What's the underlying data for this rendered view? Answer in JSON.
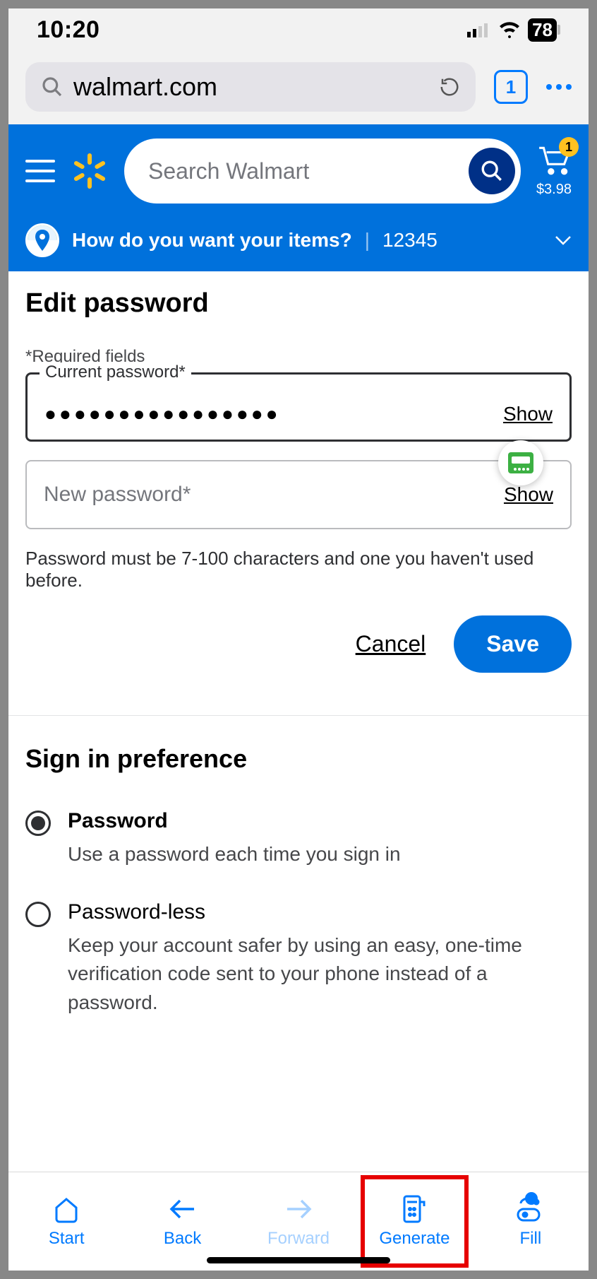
{
  "status": {
    "time": "10:20",
    "battery": "78"
  },
  "safari": {
    "url": "walmart.com",
    "tab_count": "1"
  },
  "header": {
    "search_placeholder": "Search Walmart",
    "cart_badge": "1",
    "cart_total": "$3.98"
  },
  "fulfillment": {
    "question": "How do you want your items?",
    "zip": "12345"
  },
  "edit_password": {
    "heading": "Edit password",
    "required_note": "*Required fields",
    "current_label": "Current password*",
    "current_value_masked": "●●●●●●●●●●●●●●●●",
    "show": "Show",
    "new_label": "New password*",
    "hint": "Password must be 7-100 characters and one you haven't used before.",
    "cancel": "Cancel",
    "save": "Save"
  },
  "signin_pref": {
    "heading": "Sign in preference",
    "options": [
      {
        "title": "Password",
        "desc": "Use a password each time you sign in",
        "selected": true
      },
      {
        "title": "Password-less",
        "desc": "Keep your account safer by using an easy, one-time verification code sent to your phone instead of a password.",
        "selected": false
      }
    ]
  },
  "toolbar": {
    "start": "Start",
    "back": "Back",
    "forward": "Forward",
    "generate": "Generate",
    "fill": "Fill"
  }
}
